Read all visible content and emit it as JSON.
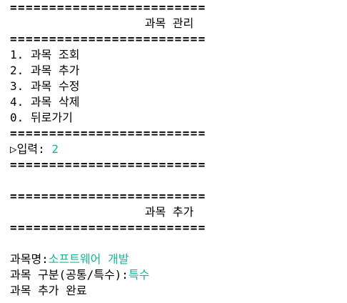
{
  "separator": "=========================",
  "menu_screen": {
    "title": "과목 관리",
    "items": [
      {
        "number": "1.",
        "label": "과목 조회"
      },
      {
        "number": "2.",
        "label": "과목 추가"
      },
      {
        "number": "3.",
        "label": "과목 수정"
      },
      {
        "number": "4.",
        "label": "과목 삭제"
      },
      {
        "number": "0.",
        "label": "뒤로가기"
      }
    ],
    "prompt_label": "▷입력: ",
    "prompt_value": "2"
  },
  "add_screen": {
    "title": "과목 추가",
    "name_label": "과목명:",
    "name_value": "소프트웨어 개발",
    "type_label": "과목 구분(공통/특수):",
    "type_value": "특수",
    "result": "과목 추가 완료"
  },
  "colors": {
    "text": "#000000",
    "input_accent": "#17b496",
    "background": "#ffffff"
  }
}
